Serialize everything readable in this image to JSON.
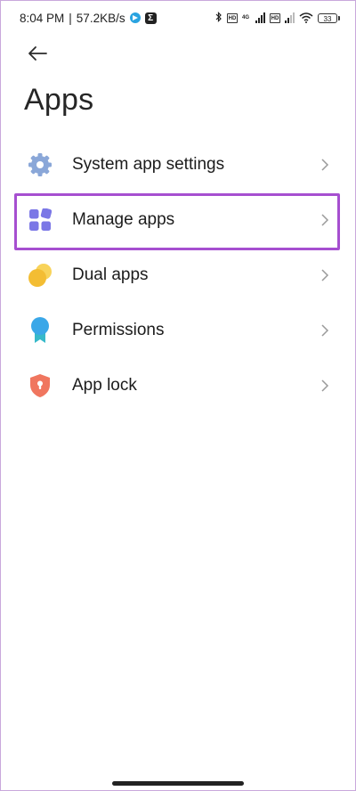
{
  "status_bar": {
    "time": "8:04 PM",
    "separator": "|",
    "net_speed": "57.2KB/s",
    "sim1_label": "4G",
    "battery_level": "33"
  },
  "header": {
    "back_icon": "arrow-left-icon",
    "title": "Apps"
  },
  "menu": {
    "items": [
      {
        "label": "System app settings",
        "icon": "gear-icon",
        "color": "#8aa7d8"
      },
      {
        "label": "Manage apps",
        "icon": "grid-icon",
        "color": "#7b77e6",
        "highlighted": true
      },
      {
        "label": "Dual apps",
        "icon": "dual-circles-icon",
        "color": "#f5c341"
      },
      {
        "label": "Permissions",
        "icon": "badge-icon",
        "color": "#3aa7e8"
      },
      {
        "label": "App lock",
        "icon": "shield-lock-icon",
        "color": "#f0765f"
      }
    ]
  },
  "colors": {
    "highlight_border": "#a64fd0",
    "chevron": "#9a9a9a"
  }
}
